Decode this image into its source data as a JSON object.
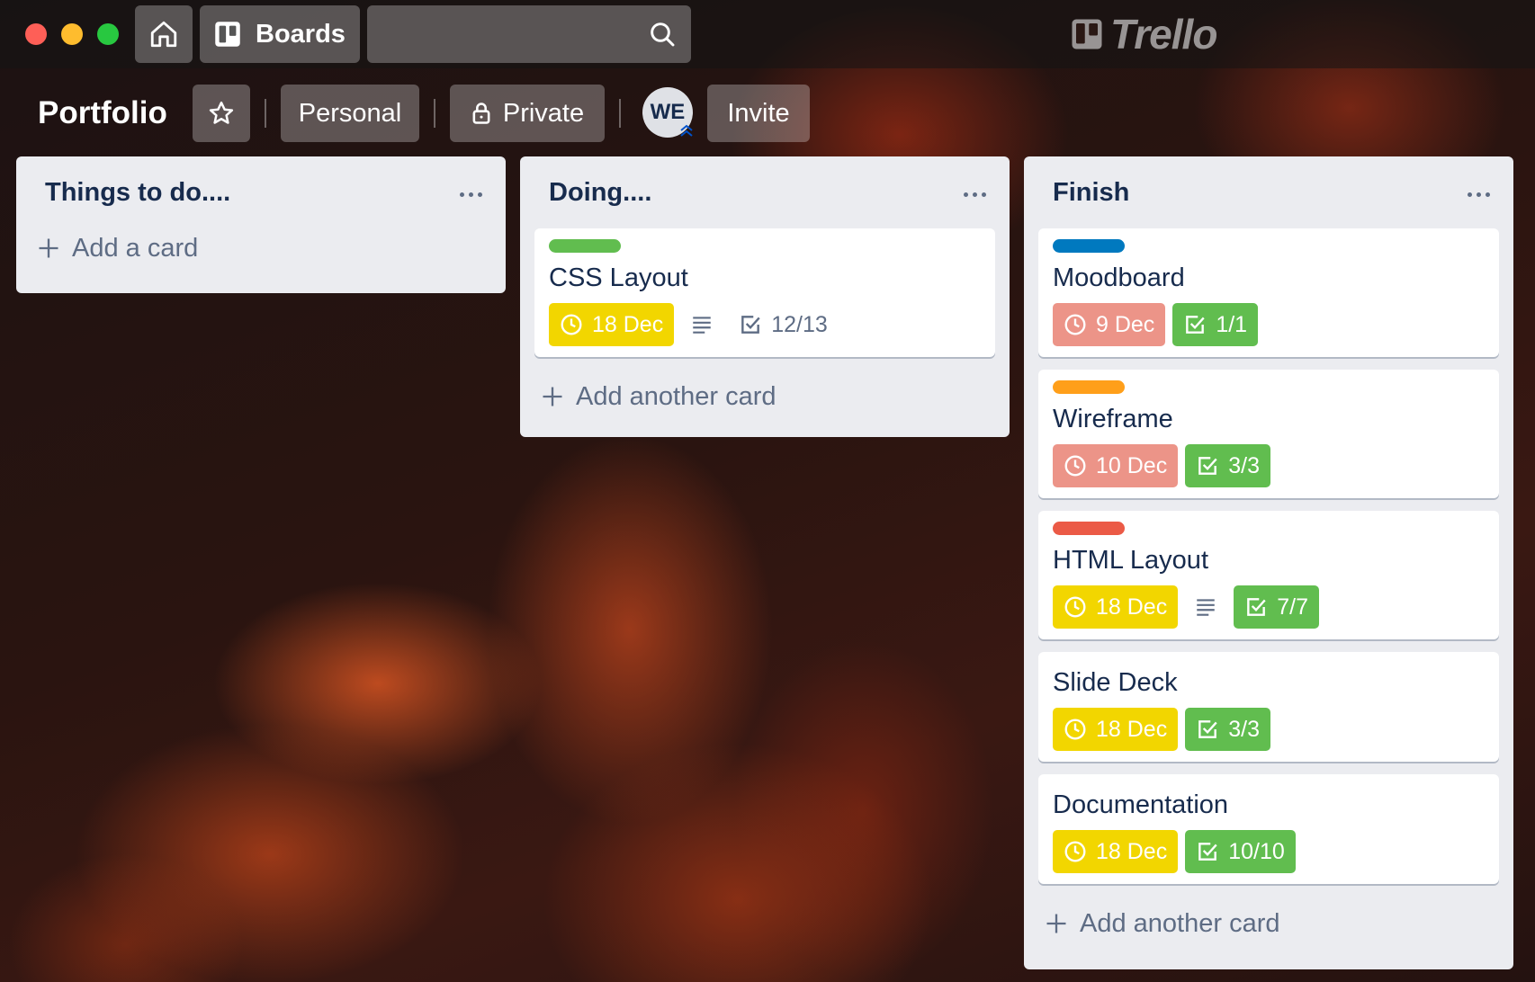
{
  "window": {
    "boards_label": "Boards",
    "search": {
      "value": ""
    },
    "logo_text": "Trello"
  },
  "board": {
    "title": "Portfolio",
    "personal_label": "Personal",
    "private_label": "Private",
    "member_initials": "WE",
    "invite_label": "Invite"
  },
  "lists": [
    {
      "title": "Things to do....",
      "add_label": "Add a card",
      "cards": []
    },
    {
      "title": "Doing....",
      "add_label": "Add another card",
      "cards": [
        {
          "label_color": "#61bd4f",
          "title": "CSS Layout",
          "due": "18 Dec",
          "due_status": "yellow",
          "has_description": true,
          "checklist": "12/13",
          "checklist_complete": false
        }
      ]
    },
    {
      "title": "Finish",
      "add_label": "Add another card",
      "cards": [
        {
          "label_color": "#0079bf",
          "title": "Moodboard",
          "due": "9 Dec",
          "due_status": "red",
          "has_description": false,
          "checklist": "1/1",
          "checklist_complete": true
        },
        {
          "label_color": "#ff9f1a",
          "title": "Wireframe",
          "due": "10 Dec",
          "due_status": "red",
          "has_description": false,
          "checklist": "3/3",
          "checklist_complete": true
        },
        {
          "label_color": "#eb5a46",
          "title": "HTML Layout",
          "due": "18 Dec",
          "due_status": "yellow",
          "has_description": true,
          "checklist": "7/7",
          "checklist_complete": true
        },
        {
          "label_color": null,
          "title": "Slide Deck",
          "due": "18 Dec",
          "due_status": "yellow",
          "has_description": false,
          "checklist": "3/3",
          "checklist_complete": true
        },
        {
          "label_color": null,
          "title": "Documentation",
          "due": "18 Dec",
          "due_status": "yellow",
          "has_description": false,
          "checklist": "10/10",
          "checklist_complete": true
        }
      ]
    }
  ],
  "colors": {
    "due_yellow": "#f2d600",
    "due_red": "#ec9488",
    "check_green": "#61bd4f",
    "list_bg": "#ebecf0",
    "text_dark": "#172b4d"
  },
  "icons": [
    "home-icon",
    "boards-icon",
    "search-icon",
    "trello-logo-icon",
    "star-icon",
    "lock-icon",
    "more-icon",
    "plus-icon",
    "clock-icon",
    "description-icon",
    "checklist-icon"
  ]
}
